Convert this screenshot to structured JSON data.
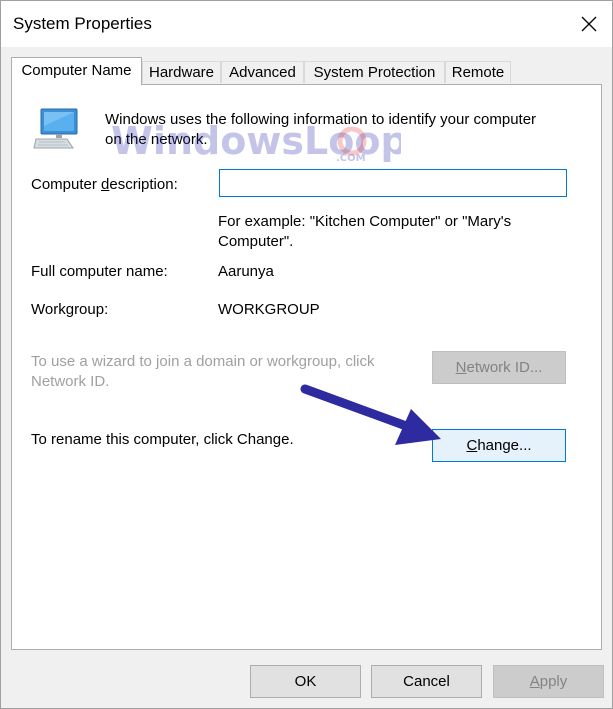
{
  "window": {
    "title": "System Properties"
  },
  "tabs": [
    {
      "label": "Computer Name",
      "active": true
    },
    {
      "label": "Hardware",
      "active": false
    },
    {
      "label": "Advanced",
      "active": false
    },
    {
      "label": "System Protection",
      "active": false
    },
    {
      "label": "Remote",
      "active": false
    }
  ],
  "panel": {
    "intro_line1": "Windows uses the following information to identify your computer",
    "intro_line2": "on the network.",
    "description_label_pre": "Computer ",
    "description_label_accel": "d",
    "description_label_post": "escription:",
    "description_value": "",
    "example_line1": "For example: \"Kitchen Computer\" or \"Mary's",
    "example_line2": "Computer\".",
    "full_name_label": "Full computer name:",
    "full_name_value": "Aarunya",
    "workgroup_label": "Workgroup:",
    "workgroup_value": "WORKGROUP",
    "domain_hint_line1": "To use a wizard to join a domain or workgroup, click",
    "domain_hint_line2": "Network ID.",
    "network_id_accel": "N",
    "network_id_rest": "etwork ID...",
    "rename_hint": "To rename this computer, click Change.",
    "change_accel": "C",
    "change_rest": "hange..."
  },
  "watermark": {
    "text_main": "WindowsLoop",
    "text_suffix": ".COM"
  },
  "footer": {
    "ok_label": "OK",
    "cancel_label": "Cancel",
    "apply_accel": "A",
    "apply_rest": "pply"
  },
  "colors": {
    "accent": "#0078d7",
    "arrow": "#2e2aa0",
    "watermark_blue": "#2f2fb0",
    "watermark_red": "#e03a3a"
  },
  "icons": {
    "close": "close-icon",
    "computer": "computer-icon",
    "annotation": "arrow-annotation"
  }
}
